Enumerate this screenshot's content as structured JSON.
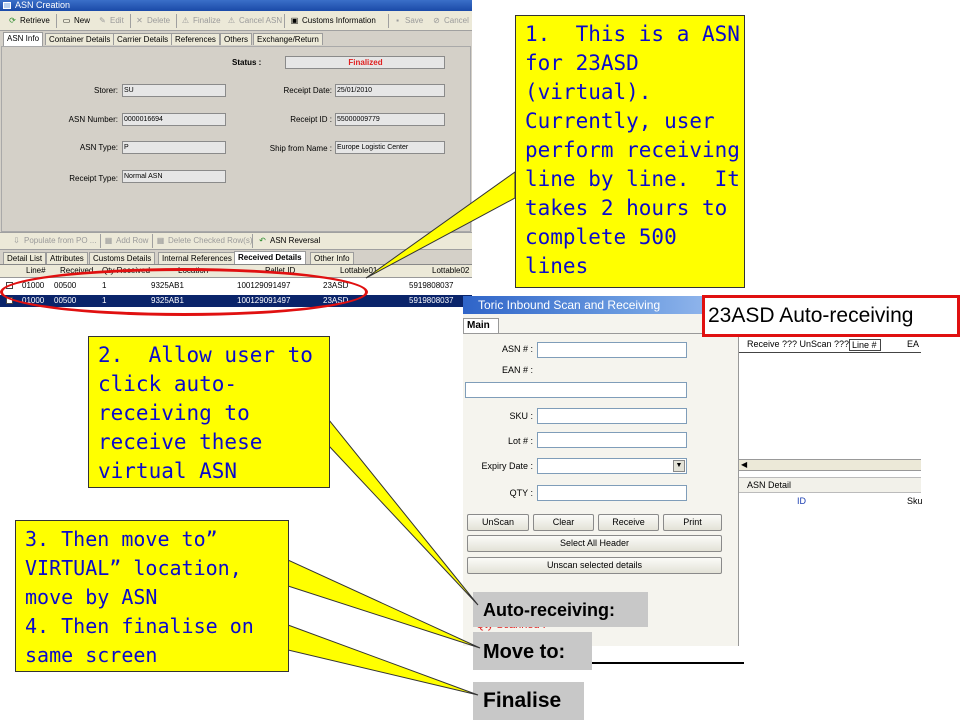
{
  "asn_window": {
    "title": "ASN Creation",
    "toolbar": {
      "retrieve": "Retrieve",
      "new": "New",
      "edit": "Edit",
      "delete": "Delete",
      "finalize": "Finalize",
      "cancel_asn": "Cancel ASN",
      "customs_information": "Customs Information",
      "save": "Save",
      "cancel": "Cancel"
    },
    "tabs": [
      "ASN Info",
      "Container Details",
      "Carrier Details",
      "References",
      "Others",
      "Exchange/Return"
    ],
    "form": {
      "status_label": "Status :",
      "status_value": "Finalized",
      "storer_label": "Storer:",
      "storer_value": "SU",
      "receipt_date_label": "Receipt Date:",
      "receipt_date_value": "25/01/2010",
      "asn_number_label": "ASN Number:",
      "asn_number_value": "0000016694",
      "receipt_id_label": "Receipt ID :",
      "receipt_id_value": "55000009779",
      "asn_type_label": "ASN Type:",
      "asn_type_value": "P",
      "ship_from_label": "Ship from Name :",
      "ship_from_value": "Europe Logistic Center",
      "receipt_type_label": "Receipt Type:",
      "receipt_type_value": "Normal ASN"
    },
    "detail_toolbar": {
      "populate": "Populate from PO ...",
      "add_row": "Add Row",
      "delete_checked": "Delete Checked Row(s)",
      "asn_reversal": "ASN Reversal"
    },
    "detail_tabs": [
      "Detail List",
      "Attributes",
      "Customs Details",
      "Internal References",
      "Received Details",
      "Other Info"
    ],
    "grid": {
      "columns": [
        "Line#",
        "Received",
        "Qty Received",
        "Location",
        "Pallet ID",
        "Lottable01",
        "Lottable02"
      ],
      "rows": [
        [
          "01000",
          "00500",
          "1",
          "9325AB1",
          "100129091497",
          "23ASD",
          "5919808037"
        ],
        [
          "01000",
          "00500",
          "1",
          "9325AB1",
          "100129091497",
          "23ASD",
          "5919808037"
        ]
      ]
    }
  },
  "callout1": {
    "lines": [
      "1.  This is a ASN",
      "for 23ASD",
      "(virtual).",
      "Currently, user",
      "perform receiving",
      "line by line.  It",
      "takes 2 hours to",
      "complete 500",
      "lines"
    ]
  },
  "callout2": {
    "lines": [
      "2.  Allow user to",
      "click auto-",
      "receiving to",
      "receive these",
      "virtual ASN"
    ]
  },
  "callout3": {
    "lines": [
      "3. Then move to”",
      "VIRTUAL” location,",
      "move by ASN",
      "4. Then finalise on",
      "same screen"
    ]
  },
  "toric_window": {
    "title": "Toric Inbound Scan and Receiving",
    "tab_main": "Main",
    "asn_label": "ASN # :",
    "ean_label": "EAN # :",
    "sku_label": "SKU :",
    "lot_label": "Lot # :",
    "expiry_label": "Expiry Date :",
    "qty_label": "QTY :",
    "btn_unscan": "UnScan",
    "btn_clear": "Clear",
    "btn_receive": "Receive",
    "btn_print": "Print",
    "btn_select_all": "Select All Header",
    "btn_unscan_selected": "Unscan selected details",
    "qty_scanned": "Qty Scanned :",
    "right_header": "Receive ???  UnScan ???",
    "right_col_line": "Line #",
    "right_col_ea": "EA",
    "asn_detail": "ASN Detail",
    "asn_detail_id": "ID",
    "asn_detail_sku": "Sku"
  },
  "labels": {
    "auto_receiving_title": "23ASD Auto-receiving",
    "auto_receiving": "Auto-receiving:",
    "move_to": "Move to:",
    "finalise": "Finalise"
  },
  "colors": {
    "callout_bg": "#ffff00",
    "callout_text": "#0a0acc",
    "highlight": "#e01010"
  }
}
